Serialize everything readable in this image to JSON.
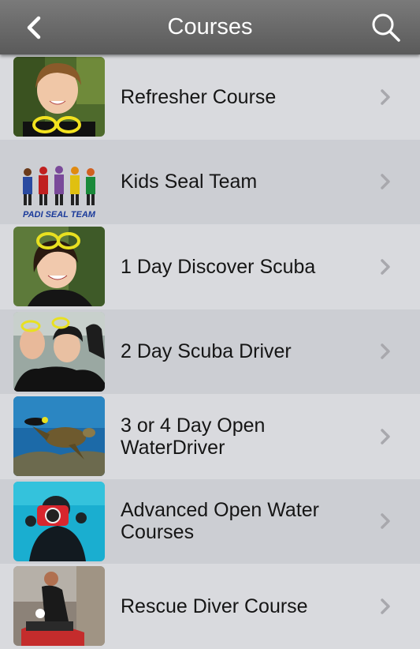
{
  "header": {
    "title": "Courses",
    "back_icon": "chevron-left-icon",
    "search_icon": "search-icon"
  },
  "colors": {
    "navbar": "#666666",
    "row_light": "#d9dade",
    "row_dark": "#ccced3",
    "text": "#151515",
    "chevron": "#a8a8ad"
  },
  "courses": [
    {
      "label": "Refresher Course",
      "thumb": "woman-with-dive-mask-photo"
    },
    {
      "label": "Kids Seal Team",
      "thumb": "padi-seal-team-logo"
    },
    {
      "label": "1 Day Discover Scuba",
      "thumb": "smiling-diver-photo"
    },
    {
      "label": "2 Day Scuba Driver",
      "thumb": "divers-group-photo"
    },
    {
      "label": "3 or 4 Day Open WaterDriver",
      "thumb": "underwater-turtle-photo"
    },
    {
      "label": "Advanced Open Water Courses",
      "thumb": "underwater-camera-diver-photo"
    },
    {
      "label": "Rescue Diver Course",
      "thumb": "rescue-training-photo"
    }
  ],
  "logo_text": "PADI SEAL TEAM"
}
